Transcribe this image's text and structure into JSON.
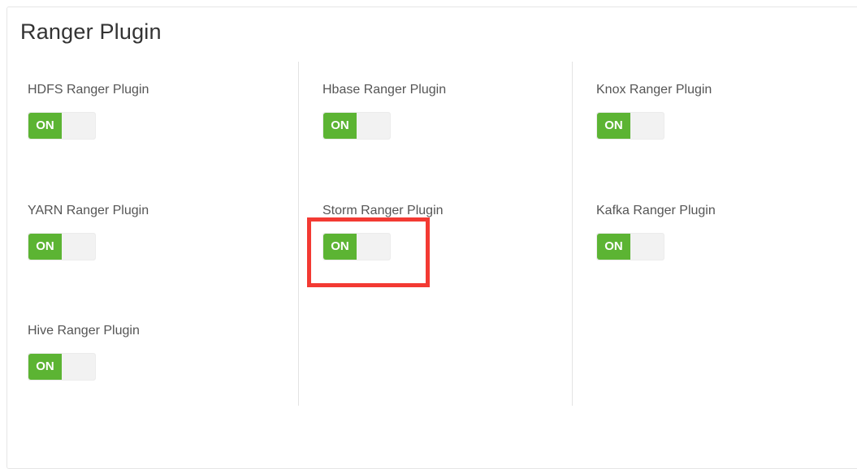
{
  "panel": {
    "title": "Ranger Plugin"
  },
  "plugins": [
    {
      "label": "HDFS Ranger Plugin",
      "state_label": "ON",
      "enabled": true
    },
    {
      "label": "Hbase Ranger Plugin",
      "state_label": "ON",
      "enabled": true
    },
    {
      "label": "Knox Ranger Plugin",
      "state_label": "ON",
      "enabled": true
    },
    {
      "label": "YARN Ranger Plugin",
      "state_label": "ON",
      "enabled": true
    },
    {
      "label": "Storm Ranger Plugin",
      "state_label": "ON",
      "enabled": true
    },
    {
      "label": "Kafka Ranger Plugin",
      "state_label": "ON",
      "enabled": true
    },
    {
      "label": "Hive Ranger Plugin",
      "state_label": "ON",
      "enabled": true
    }
  ],
  "colors": {
    "toggle_on": "#5cb433",
    "toggle_off": "#f2f2f2",
    "highlight": "#f33a33"
  }
}
